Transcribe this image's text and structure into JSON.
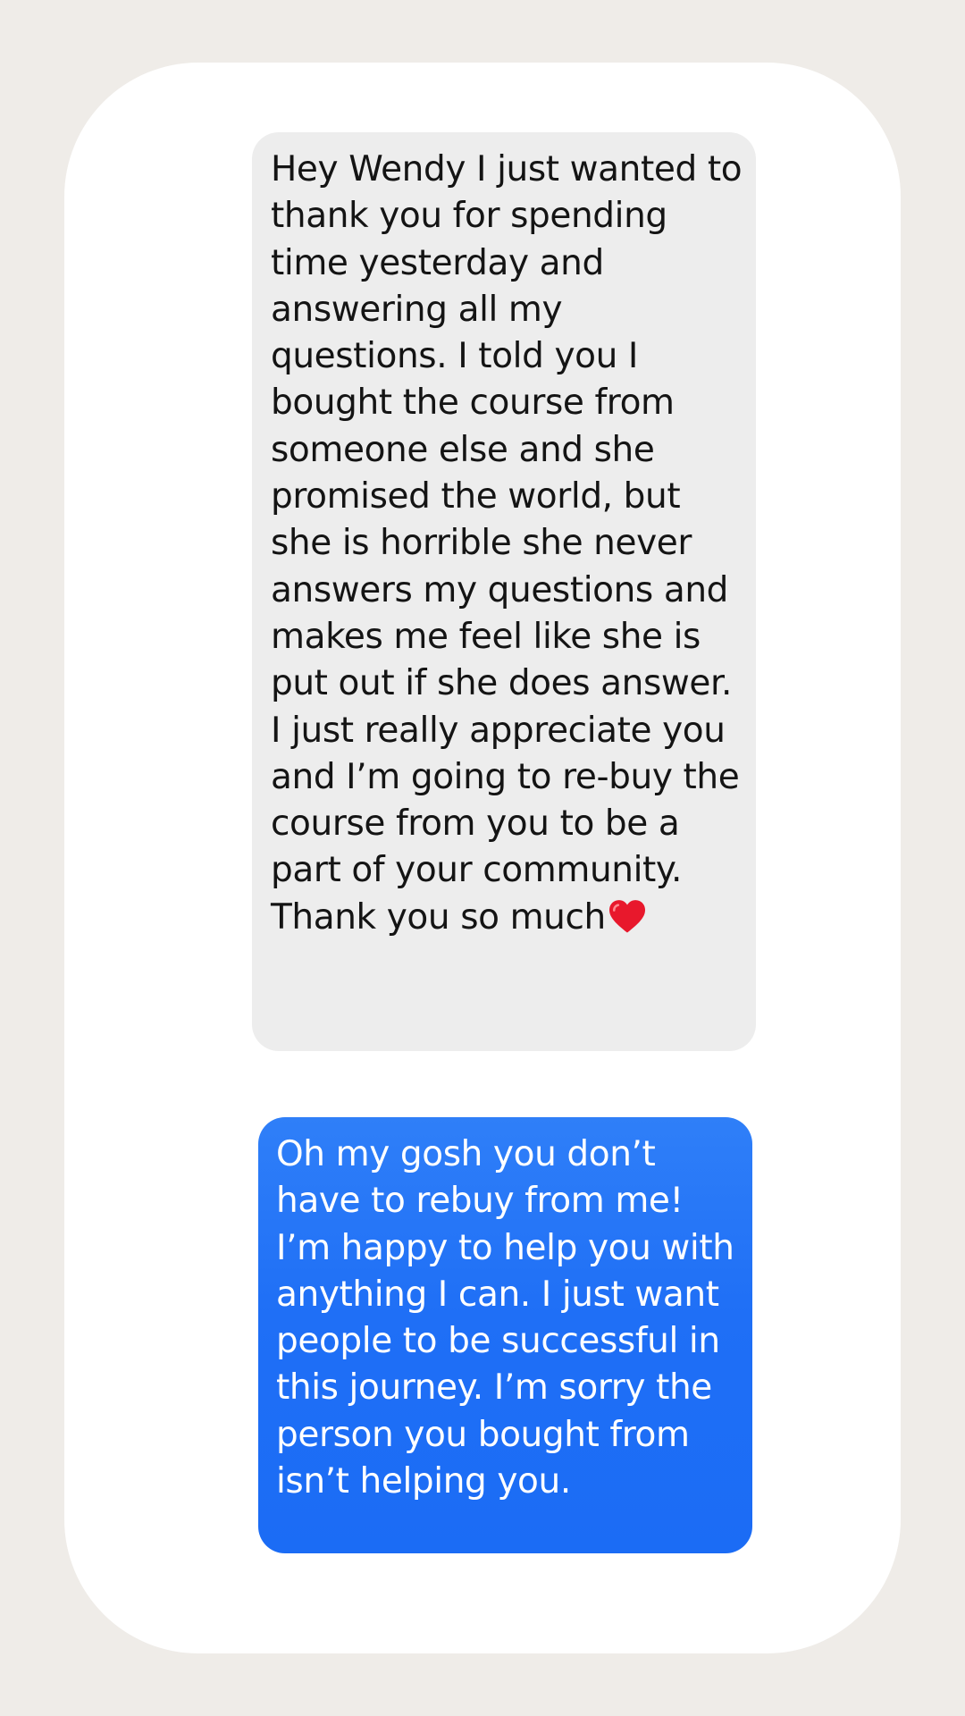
{
  "conversation": {
    "received_message": "Hey Wendy I just wanted to thank you for spending time yesterday and answering all my questions. I told you I bought the course from someone else and she promised the world, but she is horrible she never answers my questions and makes me feel like she is put out if she does answer.\nI just really appreciate you and I’m going to re-buy the course from you to be a part of your community.\nThank you so much",
    "received_trailing_emoji": "red-heart-emoji",
    "sent_message": "Oh my gosh you don’t have to rebuy from me! I’m happy to help you with anything I can. I just want people to be successful in this journey. I’m sorry the person you bought from isn’t helping you."
  },
  "colors": {
    "page_background": "#efece8",
    "card_background": "#ffffff",
    "received_bubble": "#ededed",
    "sent_bubble": "#1f6ff6",
    "heart": "#e8182c"
  }
}
